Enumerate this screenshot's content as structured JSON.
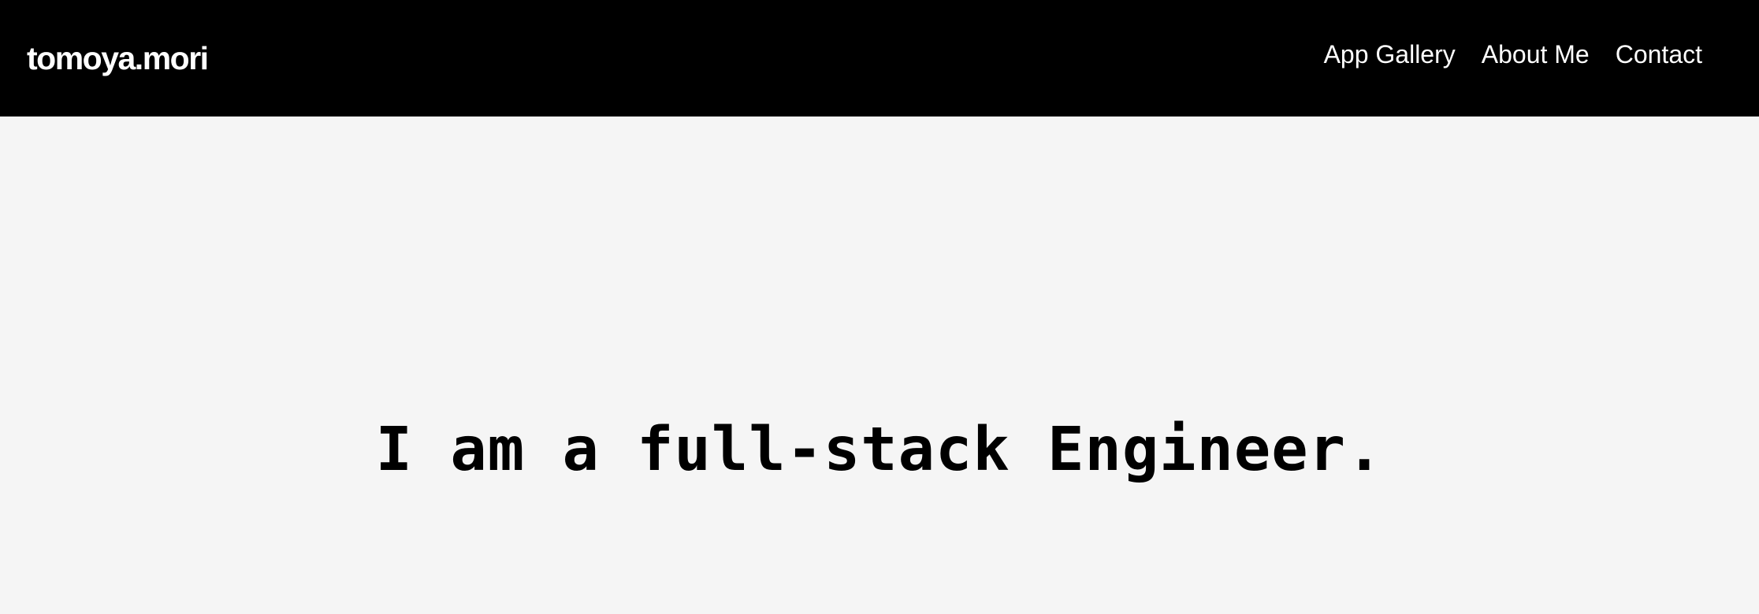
{
  "header": {
    "brand": "tomoya.mori",
    "nav": [
      {
        "label": "App Gallery"
      },
      {
        "label": "About Me"
      },
      {
        "label": "Contact"
      }
    ]
  },
  "hero": {
    "headline": "I am a full-stack Engineer."
  },
  "colors": {
    "header_background": "#000000",
    "header_text": "#ffffff",
    "page_background": "#f5f5f5",
    "headline_text": "#000000"
  }
}
